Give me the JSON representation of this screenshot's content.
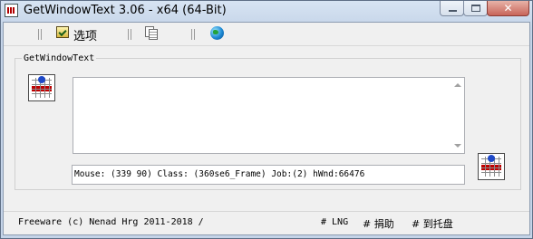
{
  "window": {
    "title": "GetWindowText 3.06 - x64 (64-Bit)",
    "close_symbol": "✕"
  },
  "toolbar": {
    "options_label": "选项",
    "icons": [
      "options-icon",
      "copy-icon",
      "globe-icon"
    ]
  },
  "group": {
    "title": "GetWindowText",
    "text_content": ""
  },
  "info": {
    "text": "Mouse: (339 90) Class: (360se6_Frame) Job:(2) hWnd:66476"
  },
  "status": {
    "left": "Freeware (c) Nenad Hrg 2011-2018 /",
    "lng": "# LNG",
    "donate": "# 捐助",
    "tray": "# 到托盘"
  },
  "colors": {
    "window_frame": "#c5d4e8",
    "client_bg": "#f0f0f0",
    "close_button": "#c8655a"
  }
}
